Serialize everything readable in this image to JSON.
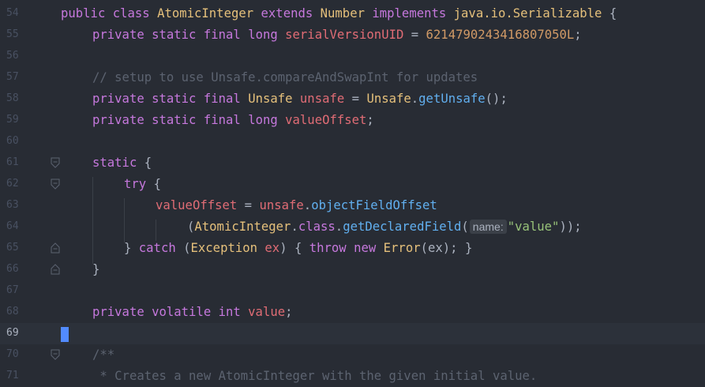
{
  "gutter": {
    "line_numbers": [
      "54",
      "55",
      "56",
      "57",
      "58",
      "59",
      "60",
      "61",
      "62",
      "63",
      "64",
      "65",
      "66",
      "67",
      "68",
      "69",
      "70",
      "71"
    ]
  },
  "code": {
    "l54": [
      "public",
      "class",
      "AtomicInteger",
      "extends",
      "Number",
      "implements",
      "java.io.Serializable",
      "{"
    ],
    "l55": [
      "private",
      "static",
      "final",
      "long",
      "serialVersionUID",
      "=",
      "6214790243416807050L",
      ";"
    ],
    "l57": "// setup to use Unsafe.compareAndSwapInt for updates",
    "l58": [
      "private",
      "static",
      "final",
      "Unsafe",
      "unsafe",
      "=",
      "Unsafe",
      ".",
      "getUnsafe",
      "();"
    ],
    "l59": [
      "private",
      "static",
      "final",
      "long",
      "valueOffset",
      ";"
    ],
    "l61": [
      "static",
      "{"
    ],
    "l62": [
      "try",
      "{"
    ],
    "l63": [
      "valueOffset",
      "=",
      "unsafe",
      ".",
      "objectFieldOffset"
    ],
    "l64": [
      "(",
      "AtomicInteger",
      ".",
      "class",
      ".",
      "getDeclaredField",
      "(",
      "name:",
      "\"value\"",
      "));"
    ],
    "l65": [
      "}",
      "catch",
      "(",
      "Exception",
      "ex",
      ")",
      "{",
      "throw",
      "new",
      "Error",
      "(ex);",
      "}"
    ],
    "l66": "}",
    "l68": [
      "private",
      "volatile",
      "int",
      "value",
      ";"
    ],
    "l70": "/**",
    "l71": " * Creates a new AtomicInteger with the given initial value."
  },
  "colors": {
    "background": "#282c34",
    "keyword": "#c678dd",
    "type": "#e5c07b",
    "variable": "#e06c75",
    "function": "#61afef",
    "number": "#d19a66",
    "comment": "#5c6370",
    "string": "#98c379",
    "caret": "#528bff"
  },
  "icons": {
    "fold_marker": "fold-marker-icon"
  },
  "current_line": "69"
}
